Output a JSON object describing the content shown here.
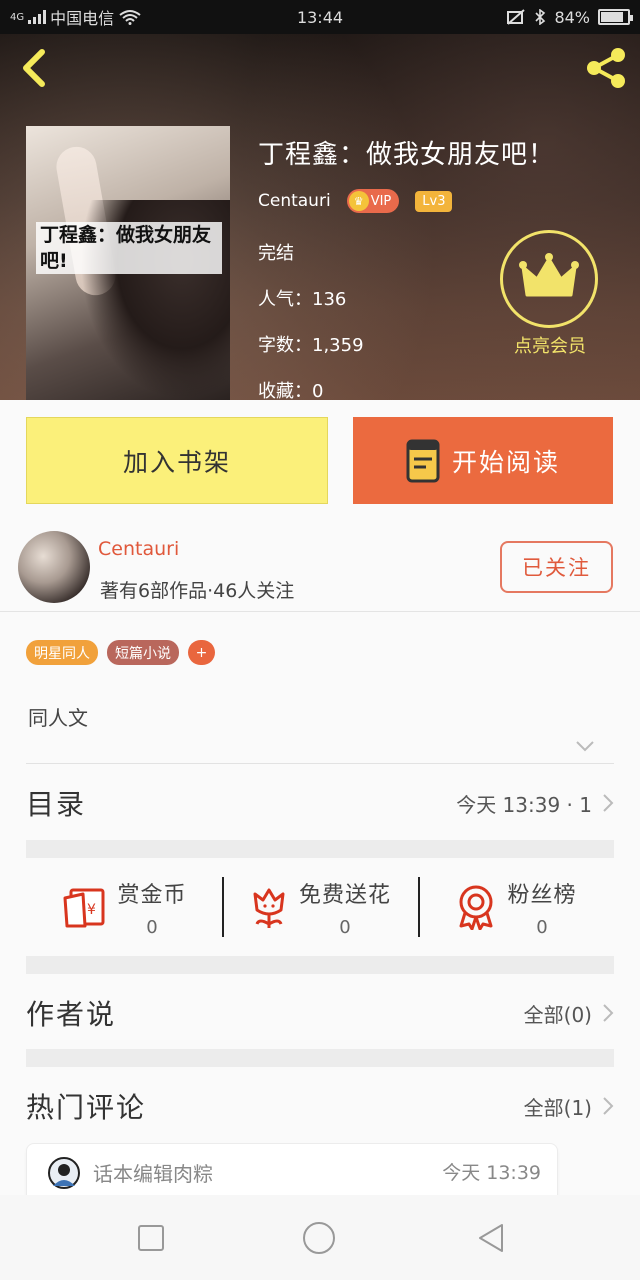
{
  "status_bar": {
    "network": "4G",
    "carrier": "中国电信",
    "time": "13:44",
    "battery": "84%",
    "battery_level": 0.84
  },
  "book": {
    "cover_text": "丁程鑫：做我女朋友吧!",
    "title": "丁程鑫：做我女朋友吧！",
    "author": "Centauri",
    "vip_label": "VIP",
    "level": "Lv3",
    "status": "完结",
    "popularity": "人气：136",
    "word_count": "字数：1,359",
    "favorites": "收藏：0",
    "vip_cta": "点亮会员"
  },
  "actions": {
    "shelf_label": "加入书架",
    "read_label": "开始阅读"
  },
  "author_block": {
    "name": "Centauri",
    "stats": "著有6部作品·46人关注",
    "follow_label": "已关注"
  },
  "tags": [
    "明星同人",
    "短篇小说"
  ],
  "tag_add": "+",
  "summary": "同人文",
  "catalog": {
    "title": "目录",
    "meta": "今天 13:39 · 1"
  },
  "stats": [
    {
      "label": "赏金币",
      "value": "0",
      "icon": "red-envelope-icon"
    },
    {
      "label": "免费送花",
      "value": "0",
      "icon": "flower-icon"
    },
    {
      "label": "粉丝榜",
      "value": "0",
      "icon": "medal-icon"
    }
  ],
  "author_says": {
    "title": "作者说",
    "meta": "全部(0)"
  },
  "hot_comments": {
    "title": "热门评论",
    "meta": "全部(1)",
    "items": [
      {
        "user": "话本编辑肉粽",
        "time": "今天 13:39"
      }
    ]
  },
  "colors": {
    "accent_orange": "#eb6a3f",
    "shelf_yellow": "#fbf07a",
    "vip_yellow": "#f2e36a",
    "author_red": "#e0583b"
  }
}
